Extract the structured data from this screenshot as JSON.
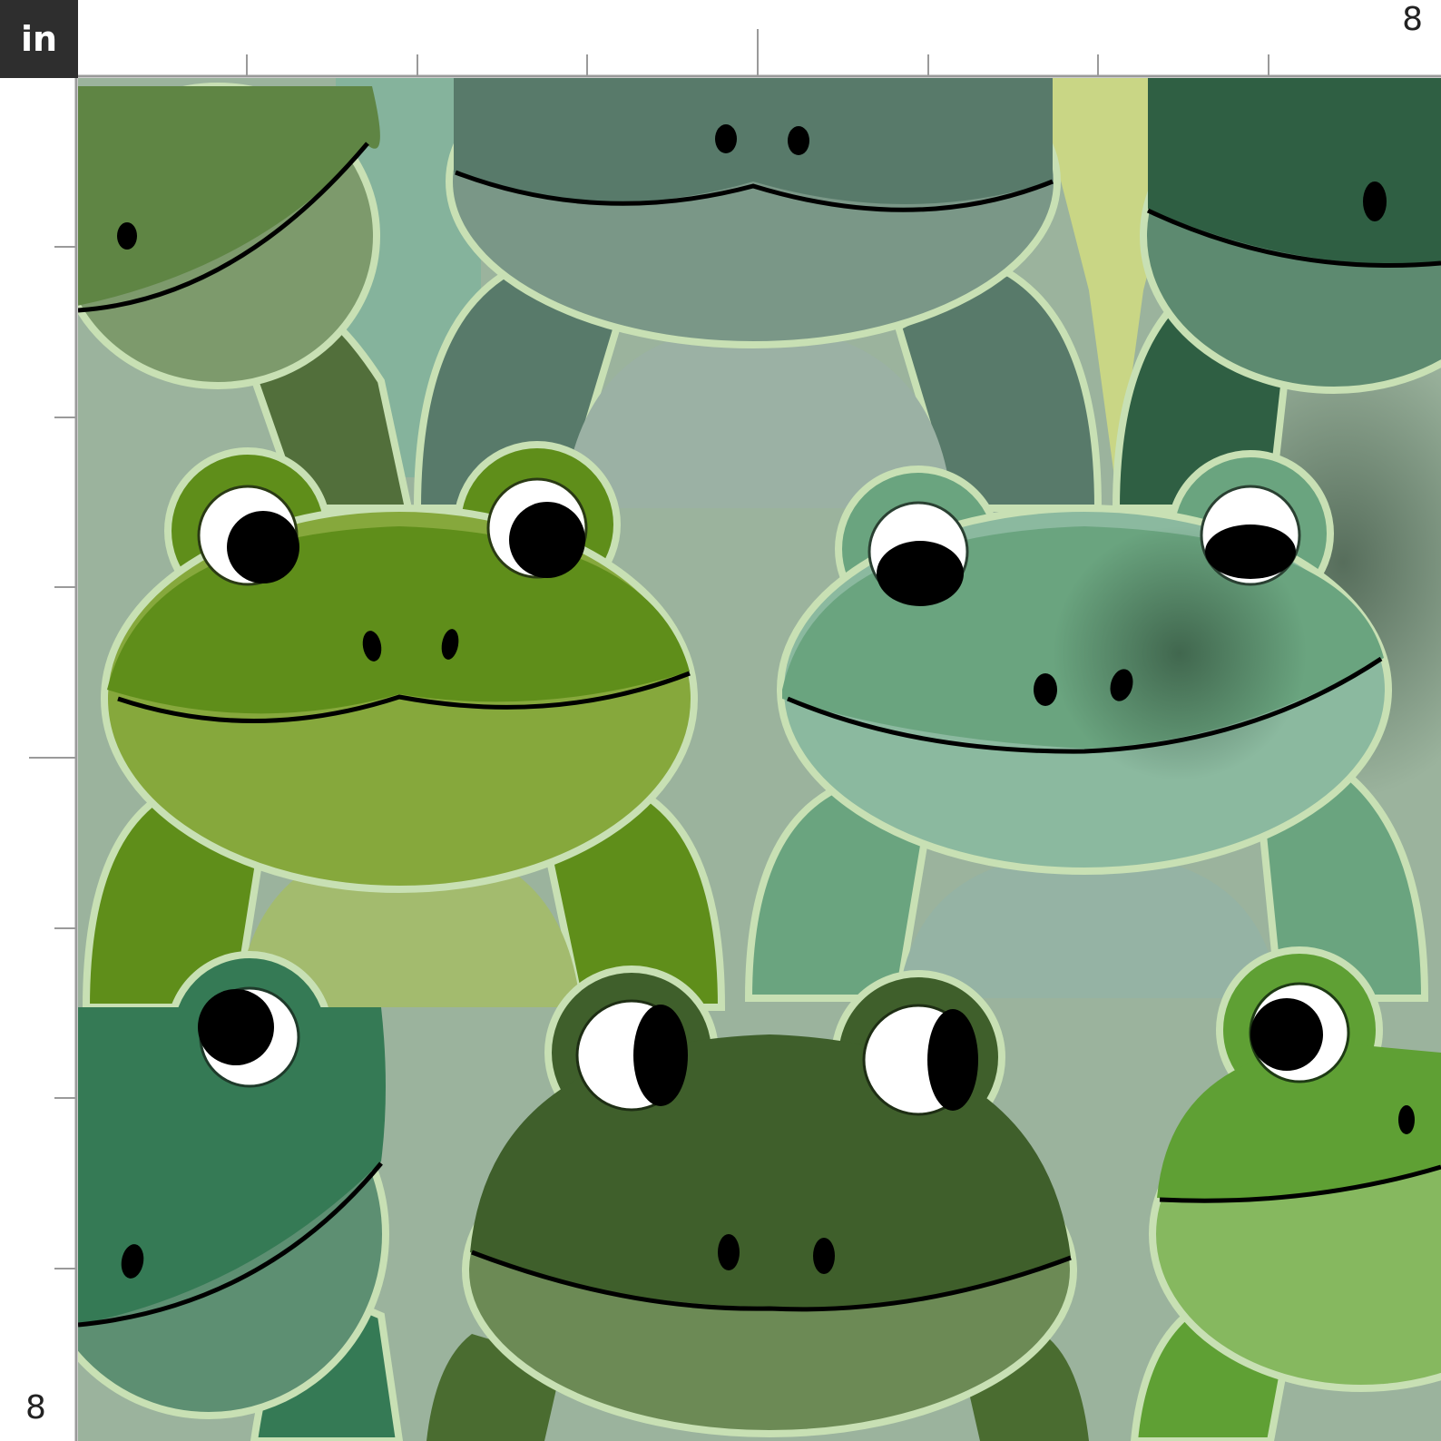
{
  "unit_toggle": {
    "label": "in"
  },
  "ruler": {
    "top_end_label": "8",
    "left_end_label": "8",
    "ticks": 8
  },
  "pattern": {
    "name": "frogs",
    "colors": {
      "bg_sage": "#9bb39d",
      "bg_teal": "#85b39c",
      "bg_lime": "#c9d685",
      "outline": "#c8e0b4",
      "frog_olive": "#5f8544",
      "frog_olive_dark": "#526f3b",
      "frog_teal_gray": "#587a6a",
      "frog_teal_belly": "#7a9787",
      "frog_forest": "#2f5f43",
      "frog_bright": "#5f8e1a",
      "frog_bright_belly": "#86a83c",
      "frog_bright_body": "#a3bb6e",
      "frog_jade": "#6aa47f",
      "frog_jade_belly": "#8bb99f",
      "frog_deep": "#3f5f2b",
      "frog_deep_belly": "#6c8a55",
      "frog_emerald": "#357a55",
      "frog_lime": "#5fa034",
      "frog_lime_belly": "#86b85f",
      "ink": "#000000",
      "eye_white": "#ffffff"
    }
  }
}
